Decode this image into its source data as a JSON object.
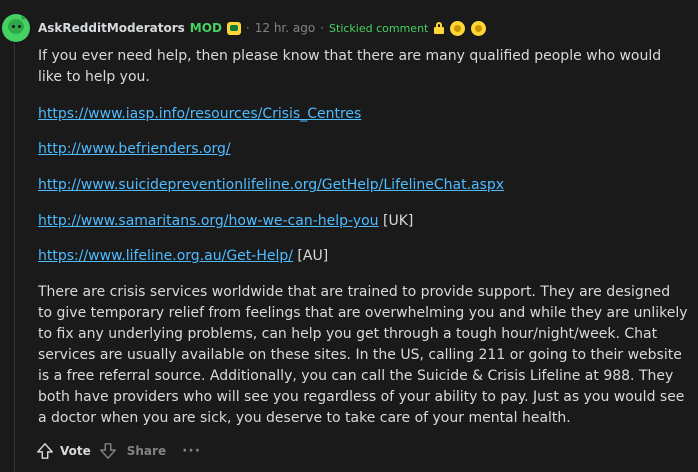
{
  "header": {
    "username": "AskRedditModerators",
    "mod_badge": "MOD",
    "separator": "·",
    "time": "12 hr. ago",
    "stickied": "Stickied comment"
  },
  "comment": {
    "intro": "If you ever need help, then please know that there are many qualified people who would like to help you.",
    "links": [
      {
        "text": "https://www.iasp.info/resources/Crisis_Centres",
        "suffix": ""
      },
      {
        "text": "http://www.befrienders.org/",
        "suffix": ""
      },
      {
        "text": "http://www.suicidepreventionlifeline.org/GetHelp/LifelineChat.aspx",
        "suffix": ""
      },
      {
        "text": "http://www.samaritans.org/how-we-can-help-you",
        "suffix": " [UK]"
      },
      {
        "text": "https://www.lifeline.org.au/Get-Help/",
        "suffix": " [AU]"
      }
    ],
    "body": "There are crisis services worldwide that are trained to provide support. They are designed to give temporary relief from feelings that are overwhelming you and while they are unlikely to fix any underlying problems, can help you get through a tough hour/night/week. Chat services are usually available on these sites. In the US, calling 211 or going to their website is a free referral source. Additionally, you can call the Suicide & Crisis Lifeline at 988. They both have providers who will see you regardless of your ability to pay. Just as you would see a doctor when you are sick, you deserve to take care of your mental health."
  },
  "actions": {
    "vote_label": "Vote",
    "share_label": "Share",
    "more_label": "···"
  },
  "colors": {
    "background": "#1a1a1b",
    "link": "#4fbcff",
    "mod_green": "#46d160",
    "muted": "#818384"
  }
}
